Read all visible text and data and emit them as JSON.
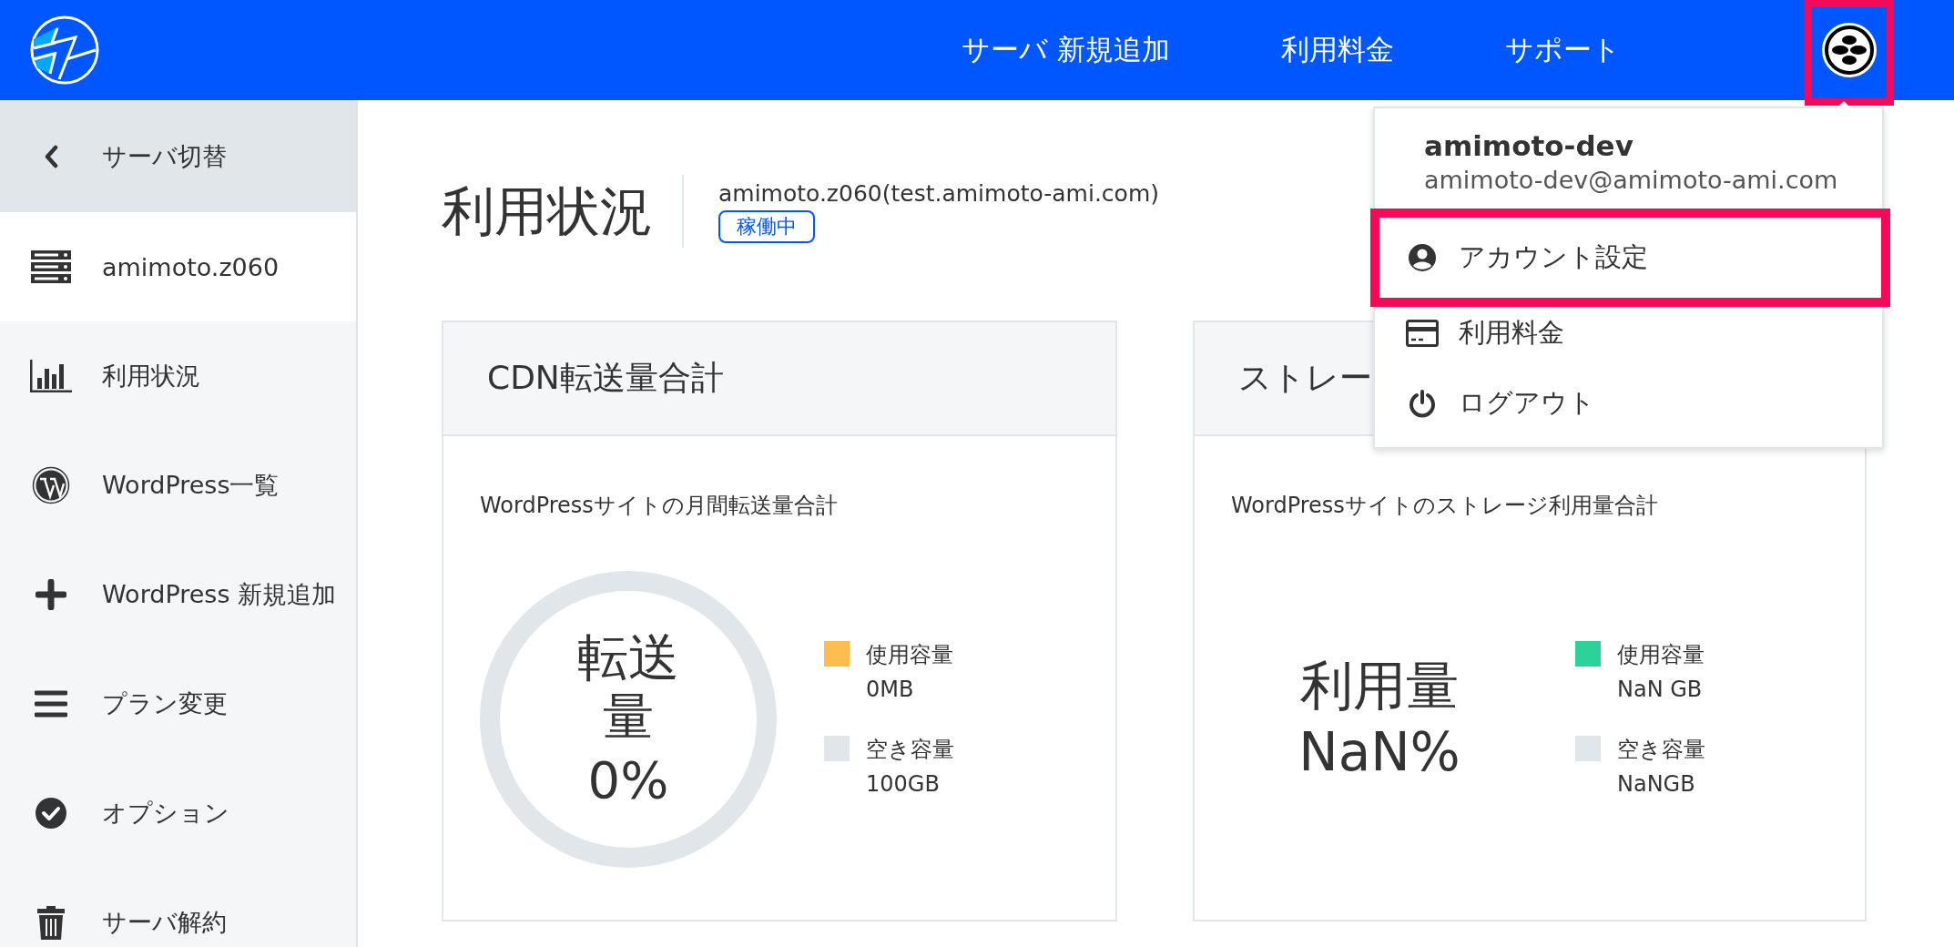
{
  "header": {
    "nav": [
      {
        "label": "サーバ 新規追加"
      },
      {
        "label": "利用料金"
      },
      {
        "label": "サポート"
      }
    ],
    "avatar": {
      "highlighted": true
    }
  },
  "sidebar": {
    "back": {
      "label": "サーバ切替"
    },
    "server": {
      "label": "amimoto.z060"
    },
    "items": [
      {
        "kind": "chart",
        "label": "利用状況"
      },
      {
        "kind": "wordpress",
        "label": "WordPress一覧"
      },
      {
        "kind": "plus",
        "label": "WordPress 新規追加"
      },
      {
        "kind": "menu",
        "label": "プラン変更"
      },
      {
        "kind": "check",
        "label": "オプション"
      },
      {
        "kind": "trash",
        "label": "サーバ解約"
      }
    ]
  },
  "page": {
    "title": "利用状況",
    "server": "amimoto.z060(test.amimoto-ami.com)",
    "status": "稼働中"
  },
  "cards": [
    {
      "kind": "ring",
      "title": "CDN転送量合計",
      "subtitle": "WordPressサイトの月間転送量合計",
      "center_label": "転送量",
      "center_value": "0%",
      "legend": [
        {
          "label": "使用容量",
          "value": "0MB",
          "color": "#fdbd4c"
        },
        {
          "label": "空き容量",
          "value": "100GB",
          "color": "#e0e6ea"
        }
      ]
    },
    {
      "kind": "plain",
      "title": "ストレー",
      "subtitle": "WordPressサイトのストレージ利用量合計",
      "center_label": "利用量",
      "center_value": "NaN%",
      "legend": [
        {
          "label": "使用容量",
          "value": "NaN GB",
          "color": "#2bd39a"
        },
        {
          "label": "空き容量",
          "value": "NaNGB",
          "color": "#e0e6ea"
        }
      ]
    }
  ],
  "user_menu": {
    "name": "amimoto-dev",
    "email": "amimoto-dev@amimoto-ami.com",
    "items": [
      {
        "kind": "account",
        "label": "アカウント設定",
        "highlighted": true
      },
      {
        "kind": "card",
        "label": "利用料金",
        "highlighted": false
      },
      {
        "kind": "power",
        "label": "ログアウト",
        "highlighted": false
      }
    ]
  }
}
